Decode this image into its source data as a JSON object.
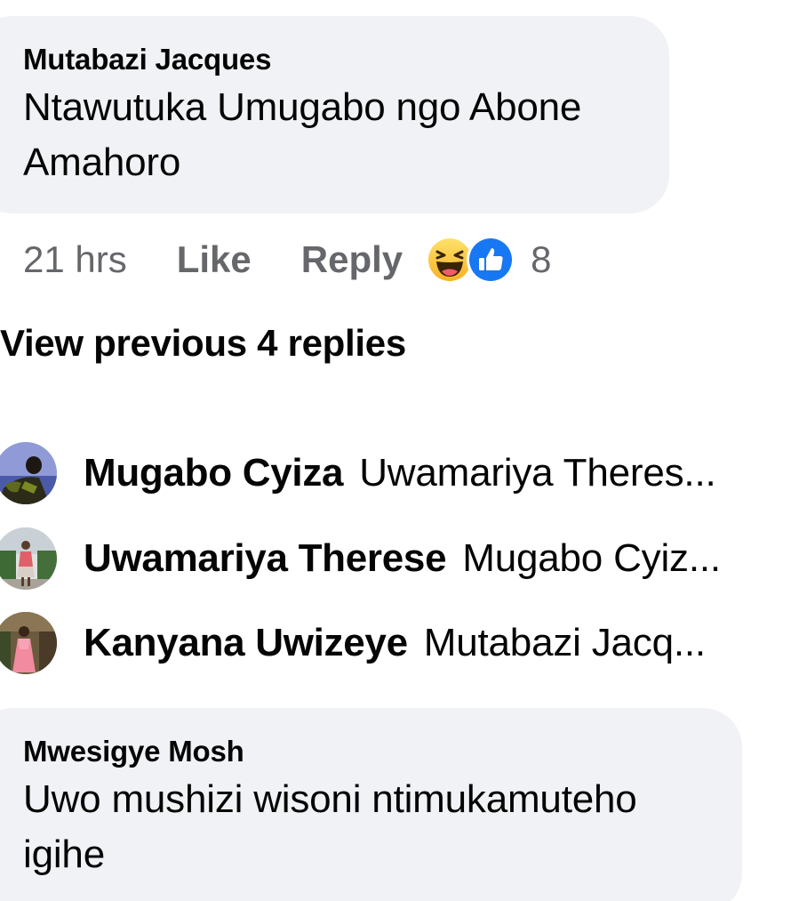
{
  "comment_1": {
    "author": "Mutabazi Jacques",
    "text_line_1": "Ntawutuka Umugabo ngo Abone",
    "text_line_2": "Amahoro"
  },
  "actions": {
    "time": "21 hrs",
    "like_label": "Like",
    "reply_label": "Reply",
    "reaction_icons": [
      "haha-reaction-icon",
      "like-reaction-icon"
    ],
    "reaction_count": "8",
    "colors": {
      "muted": "#65676b",
      "like_blue": "#1877f2",
      "haha_yellow": "#f7b125"
    }
  },
  "view_previous": {
    "label": "View previous 4 replies"
  },
  "replies": [
    {
      "name": "Mugabo Cyiza",
      "snippet": "Uwamariya Theres..."
    },
    {
      "name": "Uwamariya Therese",
      "snippet": "Mugabo Cyiz..."
    },
    {
      "name": "Kanyana Uwizeye",
      "snippet": "Mutabazi Jacq..."
    }
  ],
  "comment_2": {
    "author": "Mwesigye Mosh",
    "text_line_1": "Uwo mushizi wisoni ntimukamuteho",
    "text_line_2": "igihe"
  },
  "theme": {
    "bubble_bg": "#f0f2f5",
    "text": "#050505"
  }
}
